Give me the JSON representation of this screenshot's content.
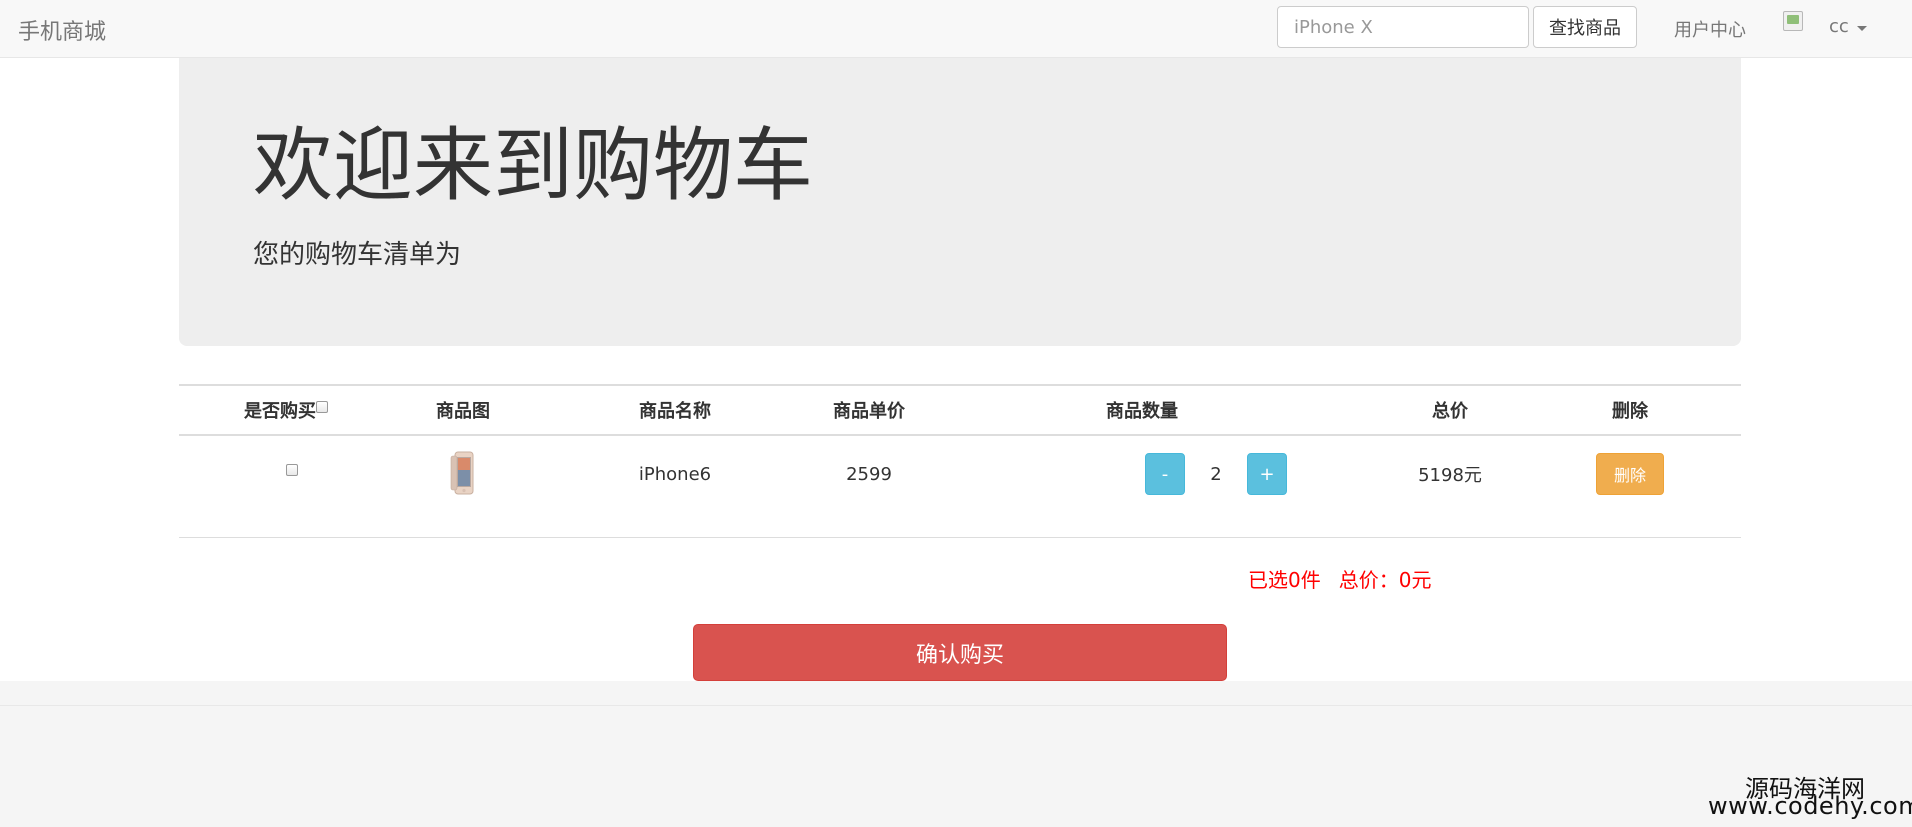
{
  "navbar": {
    "brand": "手机商城",
    "search_placeholder": "iPhone X",
    "search_button": "查找商品",
    "user_center": "用户中心",
    "username": "cc"
  },
  "jumbotron": {
    "title": "欢迎来到购物车",
    "subtitle": "您的购物车清单为"
  },
  "table": {
    "headers": {
      "select": "是否购买",
      "image": "商品图",
      "name": "商品名称",
      "price": "商品单价",
      "quantity": "商品数量",
      "total": "总价",
      "delete": "删除"
    },
    "rows": [
      {
        "name": "iPhone6",
        "price": "2599",
        "minus": "-",
        "quantity": "2",
        "plus": "+",
        "total": "5198元",
        "delete_label": "删除",
        "checked": false
      }
    ]
  },
  "summary": {
    "selected": "已选0件",
    "total": "总价：0元"
  },
  "confirm_button": "确认购买",
  "watermark": {
    "line1": "源码海洋网",
    "line2": "www.codehy.com"
  }
}
